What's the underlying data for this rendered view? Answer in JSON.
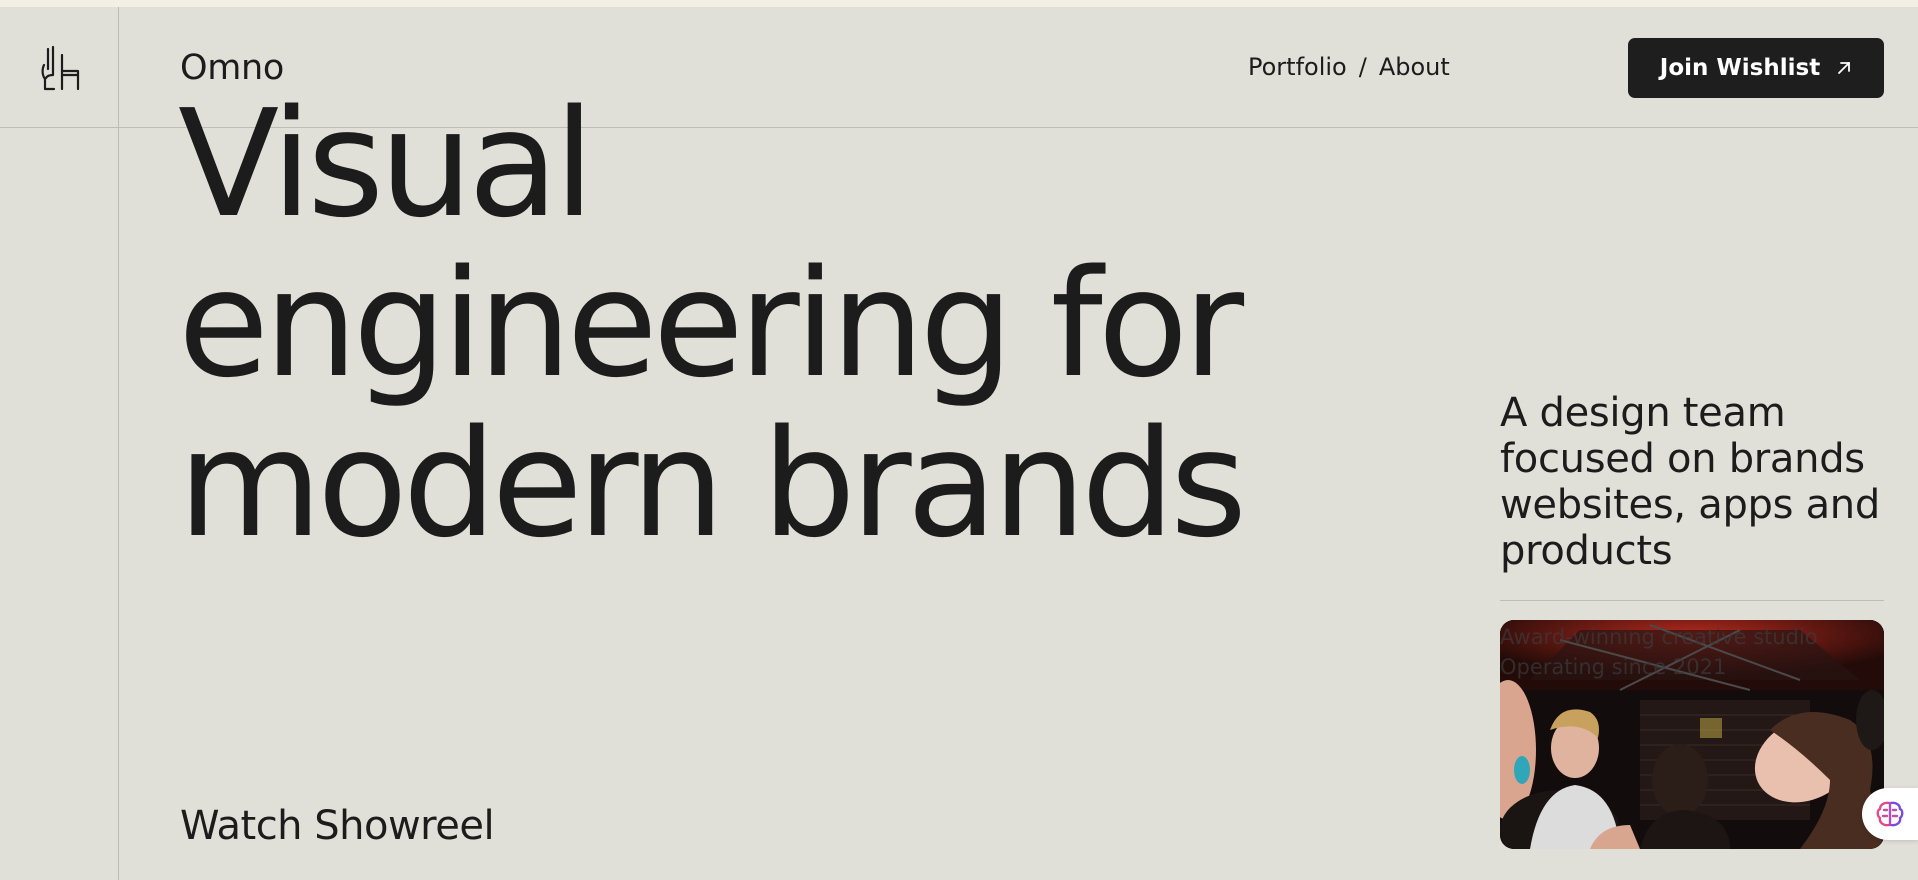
{
  "header": {
    "brand": "Omno",
    "nav": [
      {
        "label": "Portfolio"
      },
      {
        "separator": "/"
      },
      {
        "label": "About"
      }
    ],
    "cta_label": "Join Wishlist"
  },
  "hero": {
    "lines": [
      "Visual",
      "engineering for",
      "modern brands"
    ]
  },
  "showreel_label": "Watch Showreel",
  "sidebar": {
    "tagline_lines": [
      "A design team",
      "focused on brands",
      "websites, apps and",
      "products"
    ],
    "caption_lines": [
      "Award-winning creative studio",
      "Operating since 2021"
    ]
  },
  "icons": {
    "logo": "hand-chair-logo-icon",
    "cta_arrow": "arrow-up-right-icon",
    "widget": "brain-icon"
  },
  "colors": {
    "background": "#e0dfd8",
    "text": "#1c1c1c",
    "button": "#1e1e1e",
    "button_text": "#ffffff"
  }
}
